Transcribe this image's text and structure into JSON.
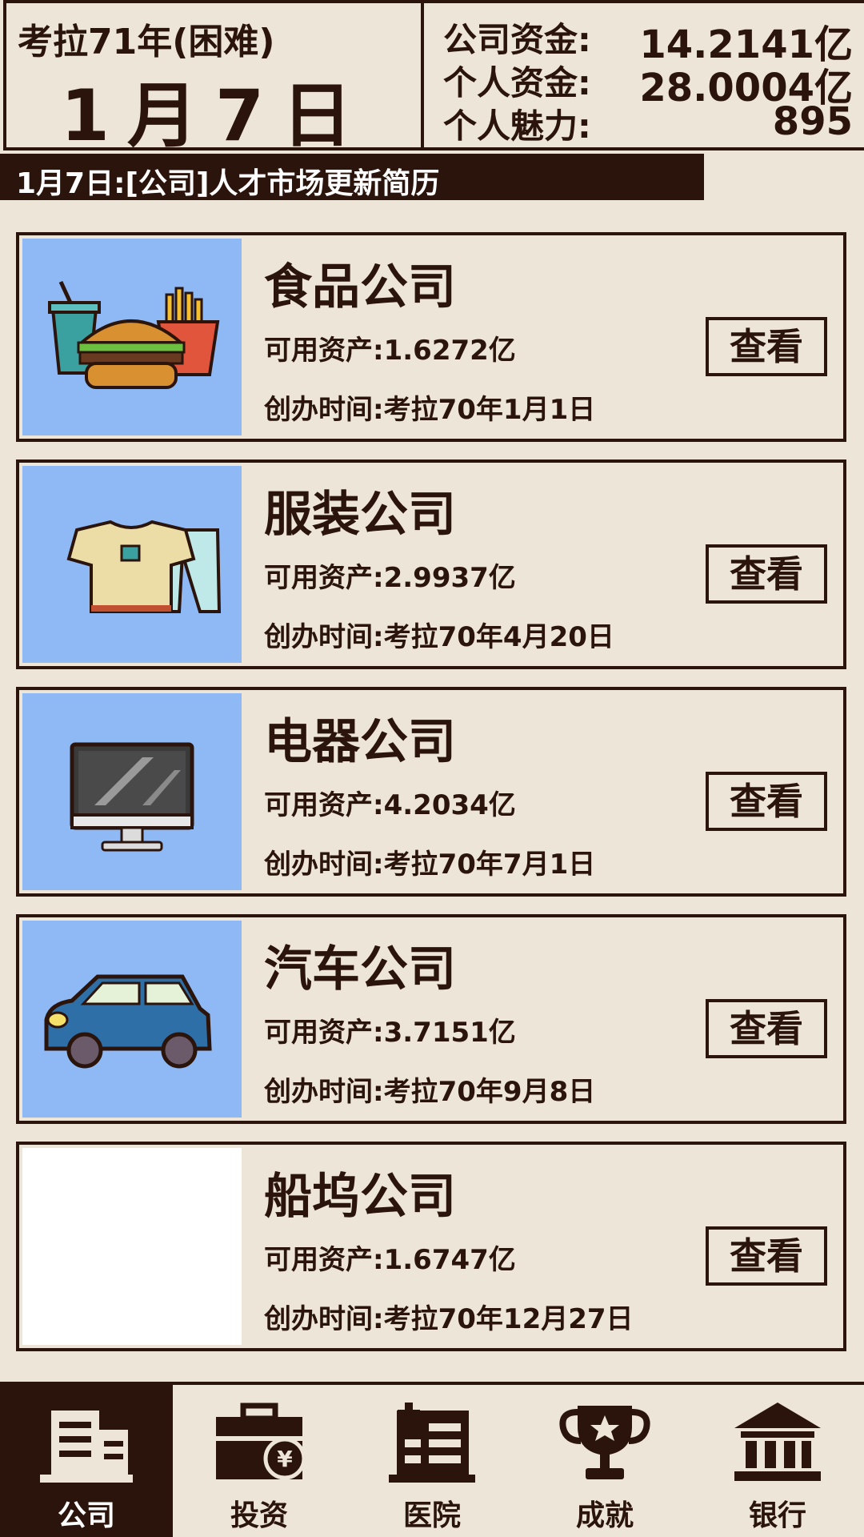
{
  "header": {
    "year_label": "考拉71年(困难)",
    "date": "1月7日",
    "stats": [
      {
        "label": "公司资金:",
        "value": "14.2141亿"
      },
      {
        "label": "个人资金:",
        "value": "28.0004亿"
      },
      {
        "label": "个人魅力:",
        "value": "895"
      }
    ]
  },
  "news": {
    "text": "1月7日:[公司]人才市场更新简历"
  },
  "companies": [
    {
      "name": "食品公司",
      "assets": "可用资产:1.6272亿",
      "founded": "创办时间:考拉70年1月1日",
      "icon": "food-icon",
      "button": "查看"
    },
    {
      "name": "服装公司",
      "assets": "可用资产:2.9937亿",
      "founded": "创办时间:考拉70年4月20日",
      "icon": "clothing-icon",
      "button": "查看"
    },
    {
      "name": "电器公司",
      "assets": "可用资产:4.2034亿",
      "founded": "创办时间:考拉70年7月1日",
      "icon": "monitor-icon",
      "button": "查看"
    },
    {
      "name": "汽车公司",
      "assets": "可用资产:3.7151亿",
      "founded": "创办时间:考拉70年9月8日",
      "icon": "car-icon",
      "button": "查看"
    },
    {
      "name": "船坞公司",
      "assets": "可用资产:1.6747亿",
      "founded": "创办时间:考拉70年12月27日",
      "icon": "",
      "button": "查看"
    }
  ],
  "nav": [
    {
      "label": "公司",
      "icon": "company-building-icon",
      "active": true
    },
    {
      "label": "投资",
      "icon": "briefcase-yen-icon",
      "active": false
    },
    {
      "label": "医院",
      "icon": "hospital-icon",
      "active": false
    },
    {
      "label": "成就",
      "icon": "trophy-icon",
      "active": false
    },
    {
      "label": "银行",
      "icon": "bank-icon",
      "active": false
    }
  ],
  "colors": {
    "background": "#ece5d8",
    "dark": "#2a140c",
    "thumb_blue": "#8fb9f5"
  }
}
